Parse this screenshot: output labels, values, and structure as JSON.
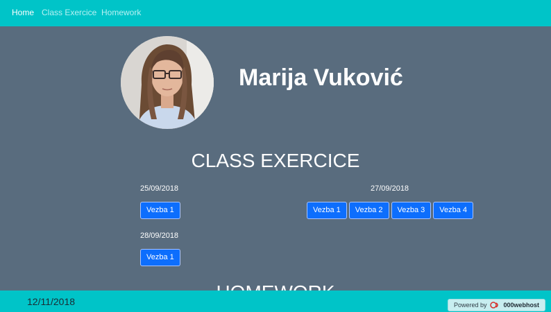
{
  "nav": {
    "items": [
      {
        "label": "Home",
        "active": true
      },
      {
        "label": "Class Exercice",
        "active": false
      },
      {
        "label": "Homework",
        "active": false
      }
    ]
  },
  "profile": {
    "name": "Marija Vuković"
  },
  "class_exercise": {
    "title": "CLASS EXERCICE",
    "groups": [
      {
        "date": "25/09/2018",
        "buttons": [
          "Vezba 1"
        ]
      },
      {
        "date": "27/09/2018",
        "buttons": [
          "Vezba 1",
          "Vezba 2",
          "Vezba 3",
          "Vezba 4"
        ]
      },
      {
        "date": "28/09/2018",
        "buttons": [
          "Vezba 1"
        ]
      }
    ]
  },
  "homework": {
    "title": "HOMEWORK"
  },
  "footer": {
    "date": "12/11/2018",
    "powered_by": "Powered by",
    "host_brand": "000webhost"
  },
  "colors": {
    "nav_bg": "#00c4c8",
    "page_bg": "#596c7e",
    "button_bg": "#0d6efd"
  }
}
